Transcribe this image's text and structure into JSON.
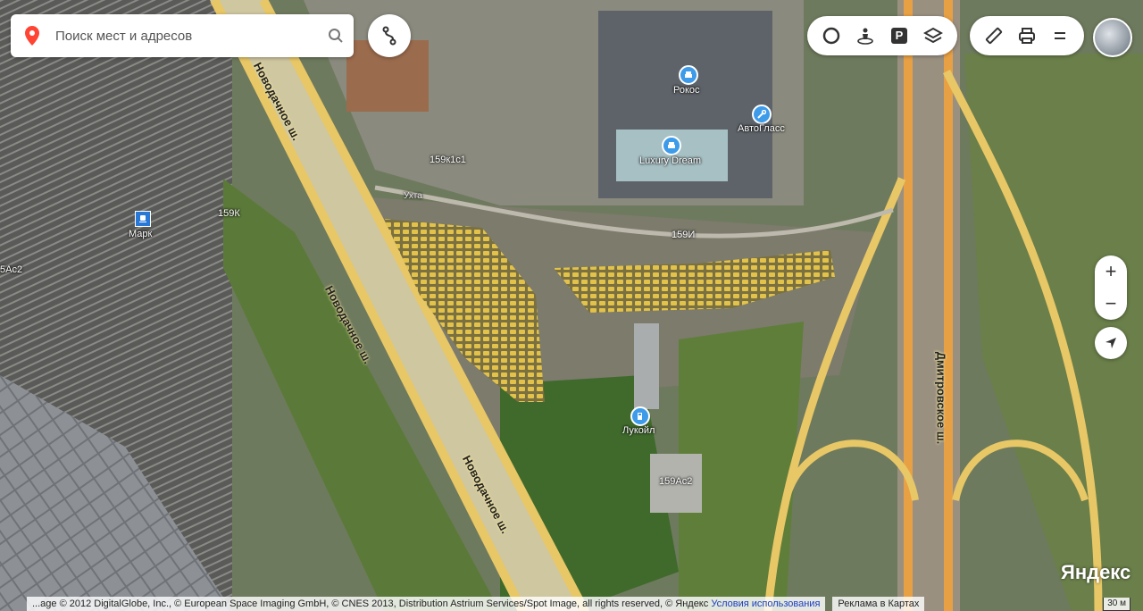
{
  "search": {
    "placeholder": "Поиск мест и адресов"
  },
  "icons": {
    "pin": "location-pin-icon",
    "search": "magnifier-icon",
    "route": "route-icon",
    "traffic": "traffic-icon",
    "panorama": "panorama-icon",
    "parking": "parking-icon",
    "layers": "layers-icon",
    "ruler": "ruler-icon",
    "print": "printer-icon",
    "menu": "menu-icon"
  },
  "toolbar": {
    "parking_label": "P"
  },
  "map": {
    "roads": {
      "novodachnoe": "Новодачное ш.",
      "dmitrovskoe": "Дмитровское ш.",
      "small_road": "Ухта"
    },
    "buildings": [
      "159к1с1",
      "159К",
      "159И",
      "159Ас2",
      "5Ас2"
    ],
    "pois": {
      "rokos": "Рокос",
      "avtoglass": "АвтоГласс",
      "luxury": "Luxury Dream",
      "lukoil": "Лукойл",
      "mark": "Марк"
    }
  },
  "zoom": {
    "in": "+",
    "out": "−"
  },
  "footer": {
    "copyright": "...age © 2012 DigitalGlobe, Inc., © European Space Imaging GmbH, © CNES 2013, Distribution Astrium Services/Spot Image, all rights reserved, © Яндекс",
    "terms": "Условия использования",
    "ads": "Реклама в Картах"
  },
  "scale": "30 м",
  "logo": "Яндекс",
  "colors": {
    "road": "#e8c766",
    "accent_red": "#f43",
    "satellite_green": "#6e8050"
  }
}
